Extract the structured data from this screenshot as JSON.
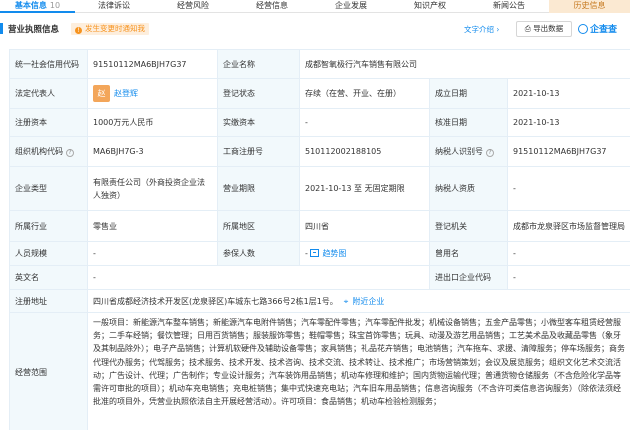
{
  "tabs": [
    {
      "label": "基本信息",
      "count": "10"
    },
    {
      "label": "法律诉讼",
      "count": ""
    },
    {
      "label": "经营风险",
      "count": ""
    },
    {
      "label": "经营信息",
      "count": ""
    },
    {
      "label": "企业发展",
      "count": ""
    },
    {
      "label": "知识产权",
      "count": ""
    },
    {
      "label": "新闻公告",
      "count": ""
    },
    {
      "label": "历史信息",
      "count": ""
    }
  ],
  "section": {
    "title": "营业执照信息",
    "status_tip": "发生变更时通知我",
    "text_intro": "文字介绍 ›",
    "export_label": "导出数据",
    "logo": "企查查"
  },
  "fields": {
    "credit_code_label": "统一社会信用代码",
    "credit_code": "91510112MA6BJH7G37",
    "company_name_label": "企业名称",
    "company_name": "成都智氧极行汽车销售有限公司",
    "legal_rep_label": "法定代表人",
    "legal_rep_avatar": "赵",
    "legal_rep": "赵登辉",
    "reg_status_label": "登记状态",
    "reg_status": "存续（在营、开业、在册）",
    "established_label": "成立日期",
    "established": "2021-10-13",
    "reg_capital_label": "注册资本",
    "reg_capital": "1000万元人民币",
    "paid_capital_label": "实缴资本",
    "paid_capital": "-",
    "approval_date_label": "核准日期",
    "approval_date": "2021-10-13",
    "org_code_label": "组织机构代码",
    "org_code": "MA6BJH7G-3",
    "biz_reg_no_label": "工商注册号",
    "biz_reg_no": "510112002188105",
    "taxpayer_id_label": "纳税人识别号",
    "taxpayer_id": "91510112MA6BJH7G37",
    "company_type_label": "企业类型",
    "company_type": "有限责任公司（外商投资企业法人独资）",
    "biz_term_label": "营业期限",
    "biz_term": "2021-10-13 至 无固定期限",
    "taxpayer_qual_label": "纳税人资质",
    "taxpayer_qual": "-",
    "industry_label": "所属行业",
    "industry": "零售业",
    "region_label": "所属地区",
    "region": "四川省",
    "authority_label": "登记机关",
    "authority": "成都市龙泉驿区市场监督管理局",
    "staff_label": "人员规模",
    "staff": "-",
    "insured_label": "参保人数",
    "insured": "-",
    "insured_link": "趋势图",
    "former_name_label": "曾用名",
    "former_name": "-",
    "english_name_label": "英文名",
    "english_name": "-",
    "import_export_label": "进出口企业代码",
    "import_export": "-",
    "address_label": "注册地址",
    "address": "四川省成都经济技术开发区(龙泉驿区)车城东七路366号2栋1层1号。",
    "address_link": "附近企业",
    "scope_label": "经营范围",
    "scope": "一般项目：新能源汽车整车销售；新能源汽车电附件销售；汽车零配件零售；汽车零配件批发；机械设备销售；五金产品零售；小微型客车租赁经营服务；二手车经销；餐饮管理；日用百货销售；服装服饰零售；鞋帽零售；珠宝首饰零售；玩具、动漫及游艺用品销售；工艺美术品及收藏品零售（象牙及其制品除外）；电子产品销售；计算机软硬件及辅助设备零售；家具销售；礼品花卉销售；电池销售；汽车拖车、求援、清障服务；停车场服务；商务代理代办服务；代驾服务；技术服务、技术开发、技术咨询、技术交流、技术转让、技术推广；市场营销策划；会议及展览服务；组织文化艺术交流活动；广告设计、代理；广告制作；专业设计服务；汽车装饰用品销售；机动车修理和维护；国内货物运输代理；普通货物仓储服务（不含危险化学品等需许可审批的项目）；机动车充电销售；充电桩销售；集中式快速充电站；汽车旧车用品销售；信息咨询服务（不含许可类信息咨询服务）（除依法须经批准的项目外，凭营业执照依法自主开展经营活动）。许可项目：食品销售；机动车检验检测服务；"
  }
}
